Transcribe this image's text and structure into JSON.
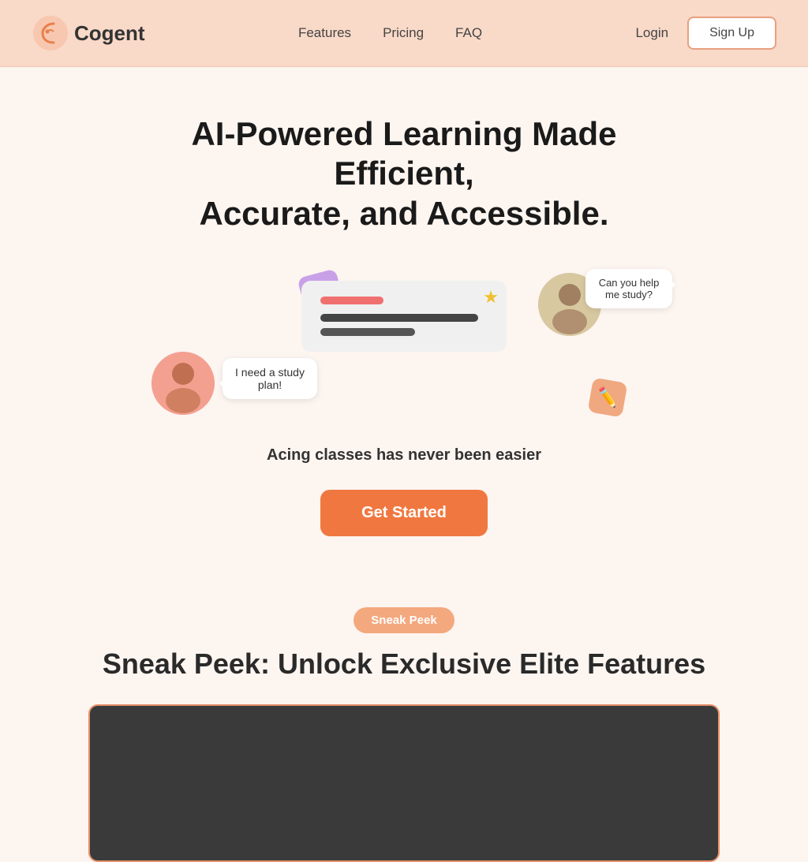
{
  "nav": {
    "logo_text": "ogent",
    "links": [
      {
        "label": "Features",
        "href": "#"
      },
      {
        "label": "Pricing",
        "href": "#"
      },
      {
        "label": "FAQ",
        "href": "#"
      }
    ],
    "login_label": "Login",
    "signup_label": "Sign Up"
  },
  "hero": {
    "heading_line1": "AI-Powered Learning Made Efficient,",
    "heading_line2": "Accurate, and Accessible.",
    "subtext": "Acing classes has never been easier",
    "cta_label": "Get Started",
    "bubble_left": "I need a study plan!",
    "bubble_right": "Can you help me study?"
  },
  "sneak_peek": {
    "badge": "Sneak Peek",
    "title": "Sneak Peek: Unlock Exclusive Elite Features"
  }
}
